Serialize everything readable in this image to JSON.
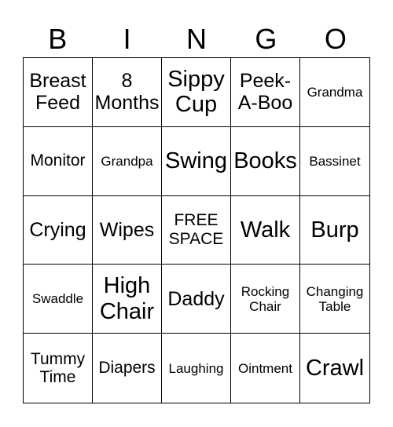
{
  "header": [
    "B",
    "I",
    "N",
    "G",
    "O"
  ],
  "cells": [
    "Breast\nFeed",
    "8\nMonths",
    "Sippy\nCup",
    "Peek-\nA-Boo",
    "Grandma",
    "Monitor",
    "Grandpa",
    "Swing",
    "Books",
    "Bassinet",
    "Crying",
    "Wipes",
    "FREE\nSPACE",
    "Walk",
    "Burp",
    "Swaddle",
    "High\nChair",
    "Daddy",
    "Rocking\nChair",
    "Changing\nTable",
    "Tummy\nTime",
    "Diapers",
    "Laughing",
    "Ointment",
    "Crawl"
  ]
}
